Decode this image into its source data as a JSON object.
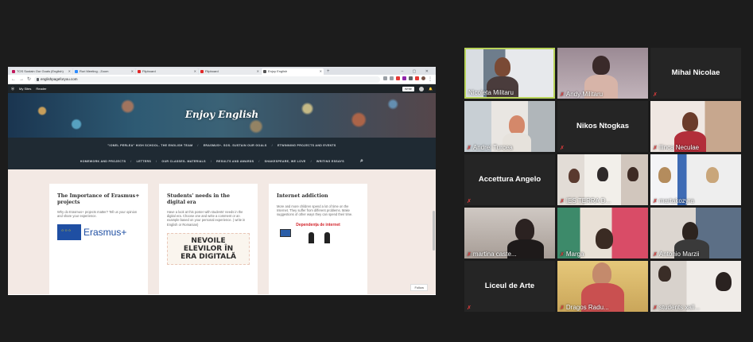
{
  "browser": {
    "tabs": [
      {
        "label": "TOS Sustain Our Goals (English)",
        "color": "#c2185b"
      },
      {
        "label": "Ruri Meeting - Zoom",
        "color": "#2d8cff"
      },
      {
        "label": "Flipboard",
        "color": "#e12828"
      },
      {
        "label": "Flipboard",
        "color": "#e12828"
      },
      {
        "label": "Enjoy English",
        "color": "#555555",
        "active": true
      }
    ],
    "new_tab": "+",
    "url": "englishpageforyou.com",
    "wp_bar": {
      "my_sites": "My Sites",
      "reader": "Reader",
      "write": "Write"
    }
  },
  "site": {
    "title": "Enjoy English",
    "menu_row1": [
      "\"IONEL PERLEA\" HIGH SCHOOL- THE ENGLISH TEAM",
      "ERASMUS+- SOS- SUSTAIN OUR GOALS",
      "ETWINNING PROJECTS AND EVENTS"
    ],
    "menu_row2": [
      "HOMEWORK AND PROJECTS",
      "LETTERS",
      "OUR CLASSES- MATERIALS",
      "RESULTS AND AWARDS",
      "SHAKESPEARE, WE LOVE",
      "WRITING ESSAYS"
    ],
    "cards": [
      {
        "title": "The Importance of Erasmus+ projects",
        "text": "Why do Erasmus+ projects matter? Tell us your opinion and share your experience.",
        "logo": "Erasmus+"
      },
      {
        "title": "Students' needs in the digital era",
        "text": "Have a look at this poster with students' needs in the digital era. Choose one and write a comment or an example based on your personal experience. ( write in English or Romanian)",
        "poster": [
          "NEVOILE",
          "ELEVILOR ÎN",
          "ERA DIGITALĂ"
        ]
      },
      {
        "title": "Internet addiction",
        "text": "More and more children spend a lot of time on the Internet. They suffer from different problems. Make suggestions of other ways they can spend their time.",
        "poster_title": "Dependența de internet"
      }
    ],
    "follow": "Follow"
  },
  "participants": [
    {
      "name": "Nicoleta Militaru",
      "video": true,
      "active": true
    },
    {
      "name": "Andy Militaru",
      "video": true
    },
    {
      "name": "Mihai Nicolae",
      "video": false
    },
    {
      "name": "Andrei Turcea",
      "video": true
    },
    {
      "name": "Nikos Ntogkas",
      "video": false
    },
    {
      "name": "Ilinca Neculae",
      "video": true
    },
    {
      "name": "Accettura Angelo",
      "video": false
    },
    {
      "name": "IES TERRA D...",
      "video": true
    },
    {
      "name": "martakozyra",
      "video": true
    },
    {
      "name": "martina caste...",
      "video": true
    },
    {
      "name": "Marga",
      "video": true
    },
    {
      "name": "Antonio Marzii",
      "video": true
    },
    {
      "name": "Liceul de Arte",
      "video": false
    },
    {
      "name": "Dragos Radu...",
      "video": true
    },
    {
      "name": "students xall...",
      "video": true
    }
  ],
  "colors": {
    "active_speaker_border": "#b8d35a",
    "muted_icon": "#e03c3c",
    "background": "#1c1c1c"
  }
}
